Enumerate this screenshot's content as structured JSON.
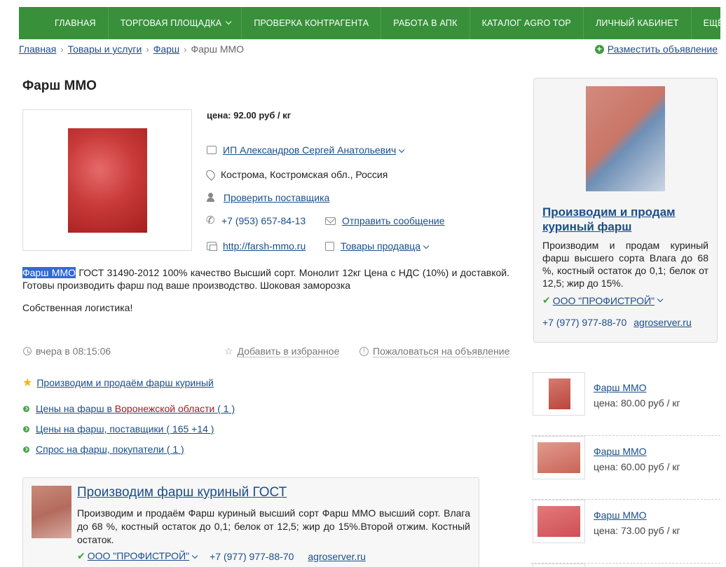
{
  "nav": {
    "items": [
      {
        "label": "ГЛАВНАЯ",
        "dropdown": false
      },
      {
        "label": "ТОРГОВАЯ ПЛОЩАДКА",
        "dropdown": true
      },
      {
        "label": "ПРОВЕРКА КОНТРАГЕНТА",
        "dropdown": false
      },
      {
        "label": "РАБОТА В АПК",
        "dropdown": false
      },
      {
        "label": "КАТАЛОГ AGRO TOP",
        "dropdown": false
      },
      {
        "label": "ЛИЧНЫЙ КАБИНЕТ",
        "dropdown": false
      },
      {
        "label": "ЕЩЁ",
        "dropdown": true
      }
    ]
  },
  "breadcrumb": {
    "items": [
      "Главная",
      "Товары и услуги",
      "Фарш"
    ],
    "current": "Фарш ММО"
  },
  "post_ad_label": "Разместить объявление",
  "listing": {
    "title": "Фарш ММО",
    "price": "цена: 92.00 руб / кг",
    "seller": "ИП Александров Сергей Анатольевич",
    "location": "Кострома, Костромская обл., Россия",
    "check_supplier": "Проверить поставщика",
    "phone": "+7 (953) 657-84-13",
    "send_message": "Отправить сообщение",
    "website": "http://farsh-mmo.ru",
    "seller_goods": "Товары продавца",
    "desc_highlight": "Фарш ММО",
    "desc_rest": " ГОСТ 31490-2012 100% качество Высший сорт. Монолит 12кг Цена с НДС (10%) и доставкой. Готовы производить фарш под ваше производство. Шоковая заморозка",
    "logistics": "Собственная логистика!",
    "posted": "вчера в 08:15:06",
    "add_favorite": "Добавить в избранное",
    "report": "Пожаловаться на объявление"
  },
  "promo_link": "Производим и продаём фарш куриный",
  "related": [
    {
      "prefix": "Цены на фарш в ",
      "highlight": "Воронежской области",
      "suffix": " ( 1 )"
    },
    {
      "prefix": "Цены на фарш, поставщики ( 165 +14 )",
      "highlight": "",
      "suffix": ""
    },
    {
      "prefix": "Спрос на фарш, покупатели ( 1 )",
      "highlight": "",
      "suffix": ""
    }
  ],
  "bottom_card": {
    "title": "Производим фарш куриный ГОСТ",
    "text": "Производим и продаём Фарш куриный высший сорт Фарш ММО высший сорт. Влага до 68 %, костный остаток до 0,1; белок от 12,5; жир до 15%.Второй отжим. Костный остаток.",
    "seller": "ООО \"ПРОФИСТРОЙ\"",
    "phone": "+7 (977) 977-88-70",
    "site": "agroserver.ru"
  },
  "right_card": {
    "title": "Производим и продам куриный фарш",
    "text": "Производим и продам куриный фарш высшего сорта Влага до 68 %, костный остаток до 0,1; белок от 12,5; жир до 15%.",
    "seller": "ООО \"ПРОФИСТРОЙ\"",
    "phone": "+7 (977) 977-88-70",
    "site": "agroserver.ru"
  },
  "similar": [
    {
      "name": "Фарш ММО",
      "price": "цена: 80.00 руб / кг"
    },
    {
      "name": "Фарш ММО",
      "price": "цена: 60.00 руб / кг"
    },
    {
      "name": "Фарш ММО",
      "price": "цена: 73.00 руб / кг"
    }
  ]
}
